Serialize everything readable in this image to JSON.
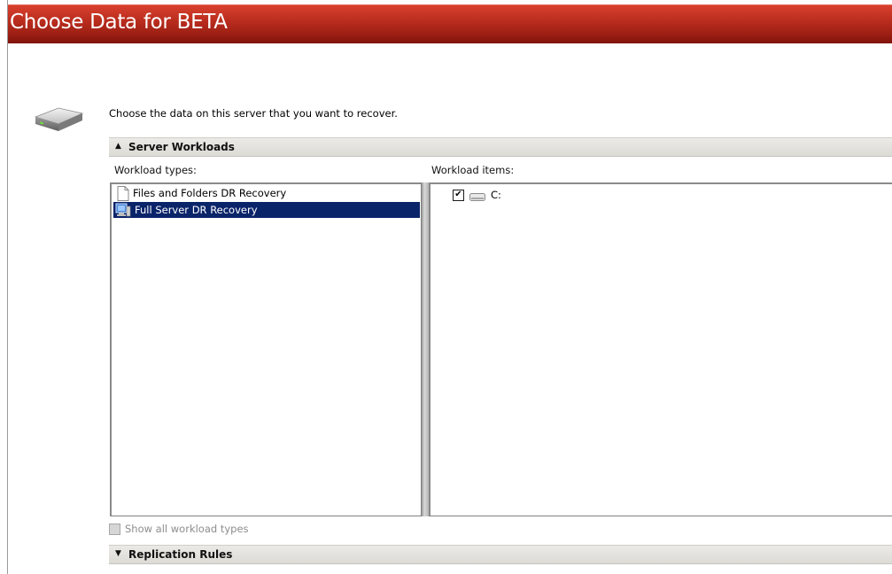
{
  "window": {
    "title": "Choose Data for BETA"
  },
  "header": {
    "icon": "hard-drive-icon",
    "instruction": "Choose the data on this server that you want to recover."
  },
  "server_workloads": {
    "label": "Server Workloads",
    "expanded": true,
    "workload_types_label": "Workload types:",
    "workload_items_label": "Workload items:",
    "workload_types": [
      {
        "label": "Files and Folders DR Recovery",
        "icon": "document-icon",
        "selected": false
      },
      {
        "label": "Full Server DR Recovery",
        "icon": "server-icon",
        "selected": true
      }
    ],
    "workload_items": [
      {
        "label": "C:",
        "icon": "drive-icon",
        "checked": true
      }
    ],
    "show_all_label": "Show all workload types",
    "show_all_checked": false,
    "show_all_enabled": false
  },
  "replication_rules": {
    "label": "Replication Rules",
    "expanded": false
  },
  "colors": {
    "title_bar": "#b02a1c",
    "selection": "#0a246a",
    "section_header": "#e3e2dd"
  }
}
